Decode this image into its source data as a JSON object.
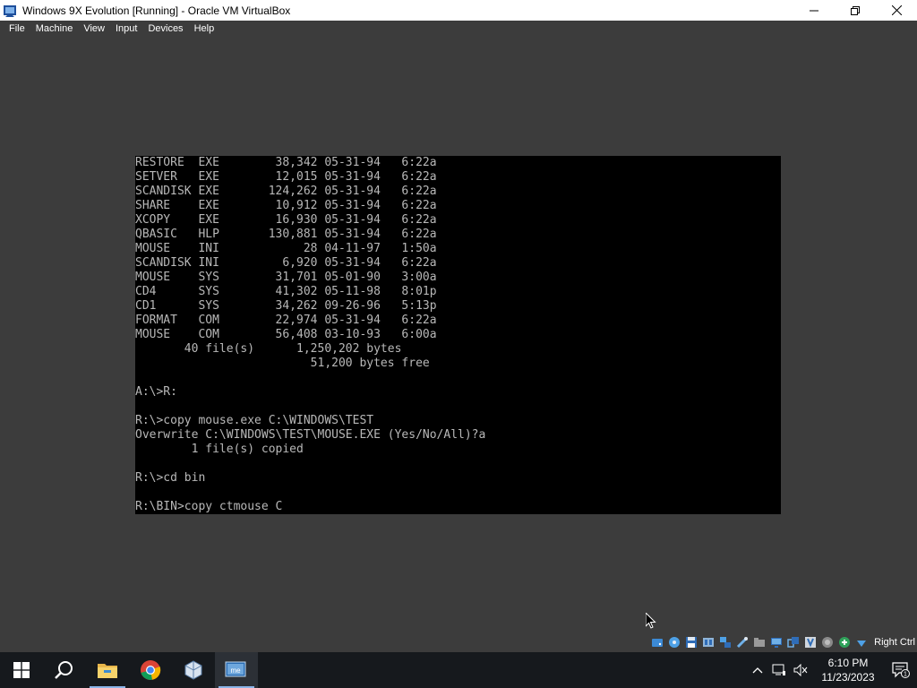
{
  "window": {
    "title": "Windows 9X Evolution [Running] - Oracle VM VirtualBox"
  },
  "menu": [
    {
      "label": "File"
    },
    {
      "label": "Machine"
    },
    {
      "label": "View"
    },
    {
      "label": "Input"
    },
    {
      "label": "Devices"
    },
    {
      "label": "Help"
    }
  ],
  "console": {
    "lines": [
      "RESTORE  EXE        38,342 05-31-94   6:22a",
      "SETVER   EXE        12,015 05-31-94   6:22a",
      "SCANDISK EXE       124,262 05-31-94   6:22a",
      "SHARE    EXE        10,912 05-31-94   6:22a",
      "XCOPY    EXE        16,930 05-31-94   6:22a",
      "QBASIC   HLP       130,881 05-31-94   6:22a",
      "MOUSE    INI            28 04-11-97   1:50a",
      "SCANDISK INI         6,920 05-31-94   6:22a",
      "MOUSE    SYS        31,701 05-01-90   3:00a",
      "CD4      SYS        41,302 05-11-98   8:01p",
      "CD1      SYS        34,262 09-26-96   5:13p",
      "FORMAT   COM        22,974 05-31-94   6:22a",
      "MOUSE    COM        56,408 03-10-93   6:00a",
      "       40 file(s)      1,250,202 bytes",
      "                         51,200 bytes free",
      "",
      "A:\\>R:",
      "",
      "R:\\>copy mouse.exe C:\\WINDOWS\\TEST",
      "Overwrite C:\\WINDOWS\\TEST\\MOUSE.EXE (Yes/No/All)?a",
      "        1 file(s) copied",
      "",
      "R:\\>cd bin",
      "",
      "R:\\BIN>copy ctmouse C"
    ]
  },
  "statusbar": {
    "host_key": "Right Ctrl",
    "icons": [
      "hard-disk-icon",
      "optical-drive-icon",
      "floppy-icon",
      "audio-icon",
      "network-icon",
      "usb-icon",
      "shared-folders-icon",
      "display-icon",
      "recording-icon",
      "mouse-integration-icon",
      "cpu-icon",
      "capture-icon",
      "arrow-down-icon"
    ]
  },
  "taskbar": {
    "apps": [
      {
        "name": "start-button"
      },
      {
        "name": "search-button"
      },
      {
        "name": "file-explorer"
      },
      {
        "name": "chrome"
      },
      {
        "name": "virtualbox-manager"
      },
      {
        "name": "windows-me-vm"
      }
    ],
    "clock_time": "6:10 PM",
    "clock_date": "11/23/2023",
    "notification_count": "1"
  },
  "colors": {
    "console_text": "#b8b8b8",
    "vm_background": "#3c3c3c",
    "taskbar": "#16191d"
  }
}
